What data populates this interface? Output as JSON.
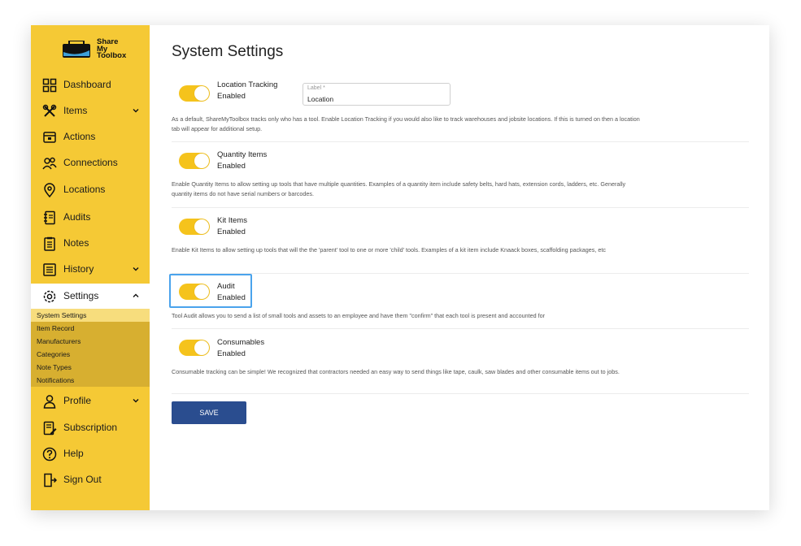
{
  "brand": {
    "logo_text_1": "Share",
    "logo_text_2": "My",
    "logo_text_3": "Toolbox"
  },
  "sidebar": {
    "items": [
      {
        "label": "Dashboard",
        "icon": "grid-icon"
      },
      {
        "label": "Items",
        "icon": "tools-icon",
        "has_chevron": true
      },
      {
        "label": "Actions",
        "icon": "actions-icon"
      },
      {
        "label": "Connections",
        "icon": "people-icon"
      },
      {
        "label": "Locations",
        "icon": "location-pin-icon"
      },
      {
        "label": "Audits",
        "icon": "notebook-icon"
      },
      {
        "label": "Notes",
        "icon": "notes-icon"
      },
      {
        "label": "History",
        "icon": "history-icon",
        "has_chevron": true
      },
      {
        "label": "Settings",
        "icon": "gear-icon",
        "has_chevron": true,
        "expanded": true
      },
      {
        "label": "Profile",
        "icon": "user-icon",
        "has_chevron": true
      },
      {
        "label": "Subscription",
        "icon": "subscription-icon"
      },
      {
        "label": "Help",
        "icon": "help-icon"
      },
      {
        "label": "Sign Out",
        "icon": "sign-out-icon"
      }
    ],
    "settings_subitems": [
      {
        "label": "System Settings",
        "selected": true
      },
      {
        "label": "Item Record"
      },
      {
        "label": "Manufacturers"
      },
      {
        "label": "Categories"
      },
      {
        "label": "Note Types"
      },
      {
        "label": "Notifications"
      }
    ]
  },
  "main": {
    "title": "System Settings",
    "options": [
      {
        "title": "Location Tracking",
        "state": "Enabled",
        "enabled": true,
        "description": "As a default, ShareMyToolbox tracks only who has a tool. Enable Location Tracking if you would also like to track warehouses and jobsite locations. If this is turned on then a location tab will appear for additional setup."
      },
      {
        "title": "Quantity Items",
        "state": "Enabled",
        "enabled": true,
        "description": "Enable Quantity Items to allow setting up tools that have multiple quantities. Examples of a quantity item include safety belts, hard hats, extension cords, ladders, etc. Generally quantity items do not have serial numbers or barcodes."
      },
      {
        "title": "Kit Items",
        "state": "Enabled",
        "enabled": true,
        "description": "Enable Kit Items to allow setting up tools that will the the 'parent' tool to one or more 'child' tools. Examples of a kit item include Knaack boxes, scaffolding packages, etc"
      },
      {
        "title": "Audit",
        "state": "Enabled",
        "enabled": true,
        "description": "Tool Audit allows you to send a list of small tools and assets to an employee and have them \"confirm\" that each tool is present and accounted for"
      },
      {
        "title": "Consumables",
        "state": "Enabled",
        "enabled": true,
        "description": "Consumable tracking can be simple! We recognized that contractors needed an easy way to send things like tape, caulk, saw blades and other consumable items out to jobs."
      }
    ],
    "label_field": {
      "label": "Label *",
      "value": "Location"
    },
    "save_label": "SAVE"
  },
  "colors": {
    "sidebar_bg": "#f5c935",
    "toggle_on": "#f5c31c",
    "save_button": "#2a4d8f",
    "highlight": "#4aa3ec"
  }
}
